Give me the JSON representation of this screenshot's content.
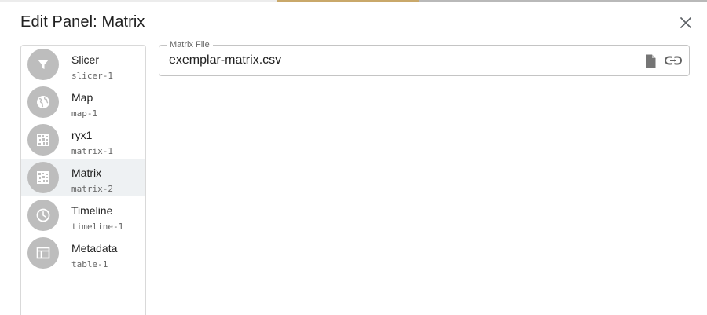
{
  "dialog": {
    "title": "Edit Panel: Matrix",
    "close_icon": "close-icon"
  },
  "panels": [
    {
      "label": "Slicer",
      "id": "slicer-1",
      "icon": "filter-icon",
      "selected": false
    },
    {
      "label": "Map",
      "id": "map-1",
      "icon": "globe-icon",
      "selected": false
    },
    {
      "label": "ryx1",
      "id": "matrix-1",
      "icon": "matrix-icon",
      "selected": false
    },
    {
      "label": "Matrix",
      "id": "matrix-2",
      "icon": "matrix-icon",
      "selected": true
    },
    {
      "label": "Timeline",
      "id": "timeline-1",
      "icon": "clock-icon",
      "selected": false
    },
    {
      "label": "Metadata",
      "id": "table-1",
      "icon": "table-icon",
      "selected": false
    }
  ],
  "matrix_file": {
    "label": "Matrix File",
    "value": "exemplar-matrix.csv",
    "file_icon": "file-icon",
    "link_icon": "link-icon"
  },
  "colors": {
    "avatar_bg": "#bdbdbd",
    "selected_bg": "#eef1f3",
    "border": "#c4c4c4"
  }
}
